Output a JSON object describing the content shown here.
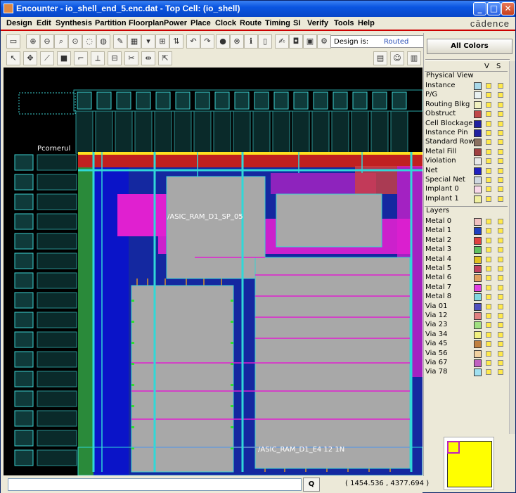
{
  "window": {
    "title": "Encounter - io_shell_end_5.enc.dat - Top Cell: (io_shell)",
    "controls": [
      "_",
      "□",
      "✕"
    ]
  },
  "menu": {
    "items": [
      "Design",
      "Edit",
      "Synthesis",
      "Partition",
      "Floorplan",
      "Power",
      "Place",
      "Clock",
      "Route",
      "Timing",
      "SI",
      "Verify",
      "Tools",
      "Help"
    ],
    "brand": "cādence"
  },
  "toolbar": {
    "design_label": "Design is:",
    "design_state": "Routed"
  },
  "canvas": {
    "labels": {
      "pcorner": "Pcornerul",
      "ram_top": "/ASIC_RAM_D1_SP_05",
      "ram_bottom": "/ASIC_RAM_D1_E4 12 1N"
    }
  },
  "panel": {
    "all_colors_label": "All Colors",
    "v_header": "V",
    "s_header": "S",
    "physical_view_header": "Physical View",
    "layers_header": "Layers",
    "physical_items": [
      {
        "name": "Instance",
        "color": "#a8d8e8"
      },
      {
        "name": "P/G",
        "color": "#e8f0f0"
      },
      {
        "name": "Routing Blkg",
        "color": "#f0f0c0"
      },
      {
        "name": "Obstruct",
        "color": "#c04848"
      },
      {
        "name": "Cell Blockage",
        "color": "#2020a0"
      },
      {
        "name": "Instance Pin",
        "color": "#2020a0"
      },
      {
        "name": "Standard Row",
        "color": "#8a7060"
      },
      {
        "name": "Metal Fill",
        "color": "#a04040"
      },
      {
        "name": "Violation",
        "color": "#e8e8e8"
      },
      {
        "name": "Net",
        "color": "#2020c0"
      },
      {
        "name": "Special Net",
        "color": "#d0d8e0"
      },
      {
        "name": "Implant 0",
        "color": "#f8d8e8"
      },
      {
        "name": "Implant 1",
        "color": "#f0f0a0"
      }
    ],
    "layer_items": [
      {
        "name": "Metal 0",
        "color": "#f0c0c0"
      },
      {
        "name": "Metal 1",
        "color": "#2040c0"
      },
      {
        "name": "Metal 2",
        "color": "#e04040"
      },
      {
        "name": "Metal 3",
        "color": "#60c060"
      },
      {
        "name": "Metal 4",
        "color": "#e0c020"
      },
      {
        "name": "Metal 5",
        "color": "#c04060"
      },
      {
        "name": "Metal 6",
        "color": "#e0a060"
      },
      {
        "name": "Metal 7",
        "color": "#e040e0"
      },
      {
        "name": "Metal 8",
        "color": "#80d8e0"
      },
      {
        "name": "Via 01",
        "color": "#5050c0"
      },
      {
        "name": "Via 12",
        "color": "#e08080"
      },
      {
        "name": "Via 23",
        "color": "#a0e080"
      },
      {
        "name": "Via 34",
        "color": "#f0f080"
      },
      {
        "name": "Via 45",
        "color": "#c08040"
      },
      {
        "name": "Via 56",
        "color": "#f0d0a0"
      },
      {
        "name": "Via 67",
        "color": "#c060c0"
      },
      {
        "name": "Via 78",
        "color": "#a0e0f0"
      }
    ]
  },
  "status": {
    "command_placeholder": "",
    "query_button": "Q",
    "coordinates": "( 1454.536 ,  4377.694 )"
  }
}
